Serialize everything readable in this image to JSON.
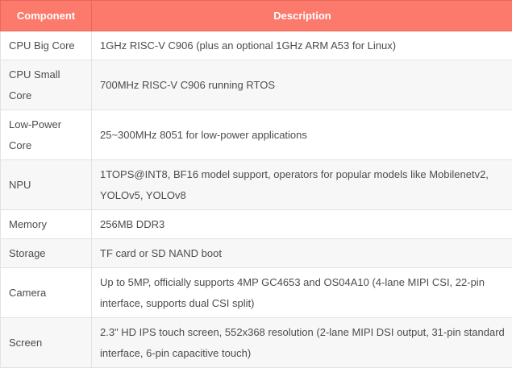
{
  "table": {
    "headers": [
      "Component",
      "Description"
    ],
    "rows": [
      {
        "component": "CPU Big Core",
        "description": "1GHz RISC-V C906 (plus an optional 1GHz ARM A53 for Linux)"
      },
      {
        "component": "CPU Small Core",
        "description": "700MHz RISC-V C906 running RTOS"
      },
      {
        "component": "Low-Power Core",
        "description": "25~300MHz 8051 for low-power applications"
      },
      {
        "component": "NPU",
        "description": "1TOPS@INT8, BF16 model support, operators for popular models like Mobilenetv2, YOLOv5, YOLOv8"
      },
      {
        "component": "Memory",
        "description": "256MB DDR3"
      },
      {
        "component": "Storage",
        "description": "TF card or SD NAND boot"
      },
      {
        "component": "Camera",
        "description": "Up to 5MP, officially supports 4MP GC4653 and OS04A10 (4-lane MIPI CSI, 22-pin interface, supports dual CSI split)"
      },
      {
        "component": "Screen",
        "description": "2.3\" HD IPS touch screen, 552x368 resolution (2-lane MIPI DSI output, 31-pin standard interface, 6-pin capacitive touch)"
      }
    ]
  }
}
